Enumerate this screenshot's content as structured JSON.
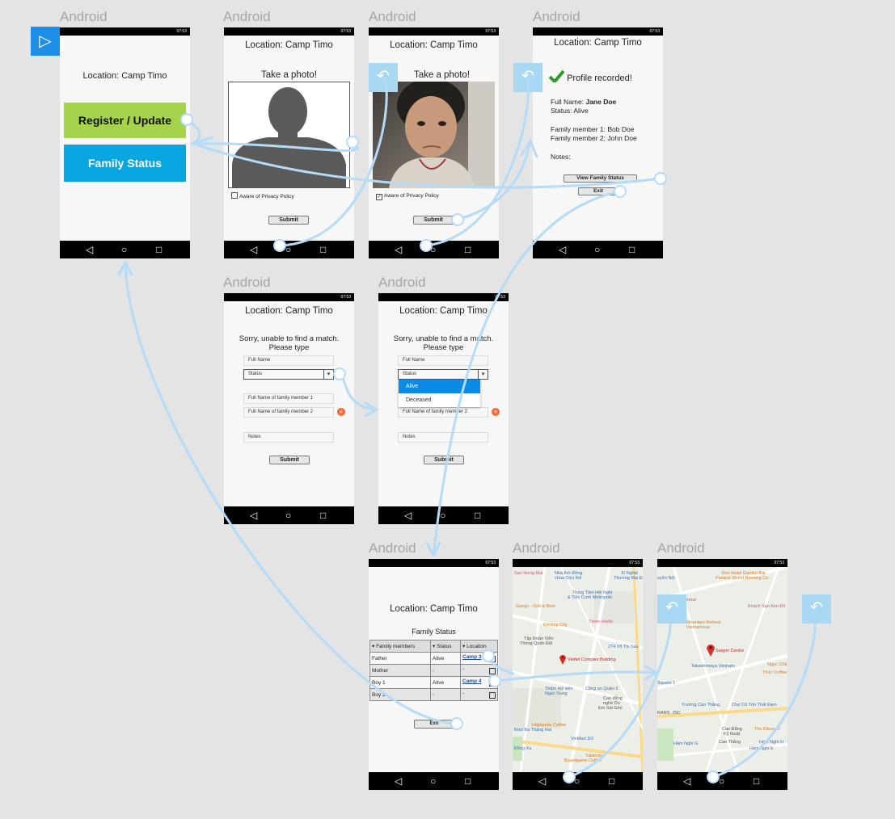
{
  "platform_label": "Android",
  "location_text": "Location: Camp Timo",
  "status_time": "07:53",
  "nav": {
    "back": "◁",
    "home": "○",
    "recents": "□"
  },
  "play_icon": "▷",
  "back_icon": "↶",
  "screen_home": {
    "register_label": "Register / Update",
    "family_status_label": "Family Status",
    "register_color": "#a5d34b",
    "family_color": "#08a6e0"
  },
  "screen_photo": {
    "title": "Take a photo!",
    "privacy_label": "Aware of Privacy Policy",
    "submit_label": "Submit"
  },
  "screen_profile": {
    "recorded_label": "Profile recorded!",
    "full_name_label": "Full Name:",
    "full_name_value": "Jane Doe",
    "status_line": "Status: Alive",
    "member1_line": "Family member 1: Bob Doe",
    "member2_line": "Family member 2: John Doe",
    "notes_label": "Notes:",
    "view_family_label": "View Family Status",
    "exit_label": "Exit"
  },
  "screen_form": {
    "sorry_line1": "Sorry, unable to find a match.",
    "sorry_line2": "Please type",
    "full_name_placeholder": "Full Name",
    "status_placeholder": "Status",
    "member1_placeholder": "Full Name of family member 1",
    "member2_placeholder": "Full Name of family member 2",
    "notes_placeholder": "Notes",
    "submit_label": "Submit",
    "dropdown_options": [
      "Alive",
      "Deceased"
    ]
  },
  "screen_family": {
    "title": "Family Status",
    "columns": [
      "▾ Family members",
      "▾ Status",
      "▾ Location"
    ],
    "rows": [
      {
        "member": "Father",
        "status": "Alive",
        "location": "Camp 3"
      },
      {
        "member": "Mother",
        "status": "-",
        "location": "-"
      },
      {
        "member": "Boy 1",
        "status": "Alive",
        "location": "Camp 4"
      },
      {
        "member": "Boy 2",
        "status": "-",
        "location": "-"
      }
    ],
    "exit_label": "Exit"
  },
  "map1": {
    "labels": [
      "San Hưng Mai",
      "Nhà thờ Đồng",
      "chùa Cứu thế",
      "Xí Nghiệ",
      "Thương Mại Đ",
      "Trung Tâm Hội Nghị",
      "& Tiệc Cưới Metropole",
      "Gangs - Grill & Beer",
      "Kimbap City",
      "Three shells",
      "Tập Đoàn Viễn",
      "Thông Quân Đội",
      "274 Võ Thị Sáu",
      "Viettel Complex Building",
      "Thẩm mỹ viện",
      "Ngọc Dung",
      "Công an Quận 3",
      "Cao đẳng",
      "nghề Du",
      "lịch Sài Gòn",
      "Highlands Coffee",
      "Mart Ba Tháng Hai",
      "VinMart 3/2",
      "Tabletop",
      "Boardgame Coffee",
      "Đồng Xu"
    ],
    "pin_label": "Viettel Complex Building"
  },
  "map2": {
    "labels": [
      "uyền Nội",
      "Rex Hotel Garden Bar",
      "Pasteur Street Brewing Co.",
      "entral",
      "Khách Sạn Kim Đô",
      "Mountain Retreat",
      "Vietnamese",
      "Takashimaya Vietnam",
      "Ngọc Châ",
      "Thức Coffee",
      "Square 1",
      "Trường Cao Thắng",
      "Chợ Cũ Tôn Thất Đạm",
      "RANS, JSC",
      "Cao Đẳng",
      "Kỹ thuật",
      "Cao Thắng",
      "The Elbow-R",
      "Hàm Nghi G",
      "Hàm Nghi E",
      "Hàm Nghi H"
    ],
    "pin_label": "Saigon Centre"
  }
}
